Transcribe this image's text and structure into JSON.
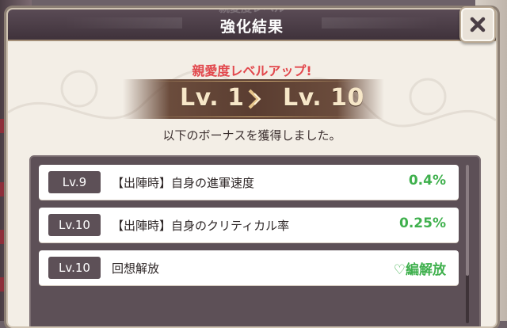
{
  "dialog": {
    "title": "強化結果",
    "title_ghost": "親愛度レベル"
  },
  "levelup": {
    "headline": "親愛度レベルアップ!",
    "from_level": "Lv. 1",
    "to_level": "Lv. 10",
    "bonus_message": "以下のボーナスを獲得しました。"
  },
  "bonuses": [
    {
      "level": "Lv.9",
      "description": "【出陣時】自身の進軍速度",
      "value": "0.4%"
    },
    {
      "level": "Lv.10",
      "description": "【出陣時】自身のクリティカル率",
      "value": "0.25%"
    },
    {
      "level": "Lv.10",
      "description": "回想解放",
      "value": "♡編解放"
    }
  ],
  "colors": {
    "accent_red": "#e2484d",
    "value_green": "#3fb04d",
    "title_bar": "#3f323b",
    "banner_brown": "#5a3d31"
  },
  "icons": {
    "close": "close-icon",
    "level_arrow": "arrow-right-icon"
  }
}
